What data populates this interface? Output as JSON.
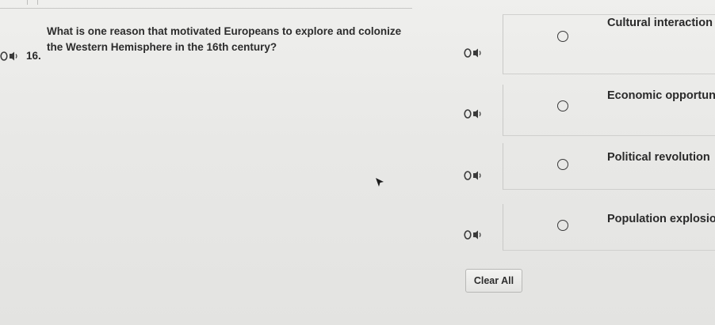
{
  "question": {
    "number": "16.",
    "text": "What is one reason that motivated Europeans to explore and colonize the Western Hemisphere in the 16th century?",
    "audio_icon": "speaker-icon"
  },
  "options": [
    {
      "label": "Cultural interaction",
      "selected": false,
      "audio_icon": "speaker-icon"
    },
    {
      "label": "Economic opportunity",
      "selected": false,
      "audio_icon": "speaker-icon"
    },
    {
      "label": "Political revolution",
      "selected": false,
      "audio_icon": "speaker-icon"
    },
    {
      "label": "Population explosion",
      "selected": false,
      "audio_icon": "speaker-icon"
    }
  ],
  "actions": {
    "clear_all_label": "Clear All"
  },
  "colors": {
    "background": "#e8e8e6",
    "text": "#2a2a2a",
    "border": "#c9c9c7"
  }
}
